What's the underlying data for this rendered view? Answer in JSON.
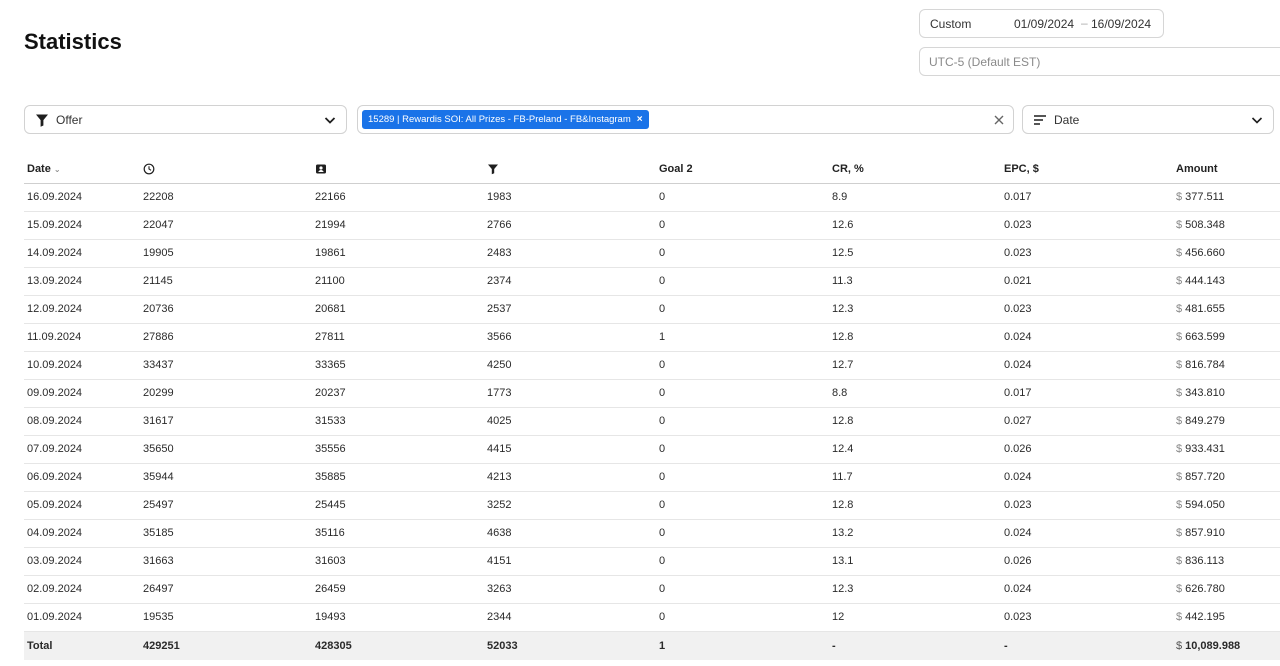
{
  "page": {
    "title": "Statistics"
  },
  "date_range": {
    "preset": "Custom",
    "from": "01/09/2024",
    "separator": "–",
    "to": "16/09/2024"
  },
  "timezone": {
    "value": "UTC-5 (Default EST)"
  },
  "filters": {
    "offer_label": "Offer",
    "selected_chip": "15289 | Rewardis SOI: All Prizes - FB-Preland - FB&Instagram",
    "chip_remove": "×",
    "group_by_label": "Date"
  },
  "colors": {
    "accent": "#1a73e8",
    "total_row_bg": "#f1f1f1"
  },
  "table": {
    "headers": {
      "date": "Date",
      "clicks_icon": "clock-icon",
      "unique_icon": "user-badge-icon",
      "conversions_icon": "funnel-icon",
      "goal2": "Goal 2",
      "cr": "CR, %",
      "epc": "EPC, $",
      "amount": "Amount"
    },
    "currency": "$",
    "rows": [
      {
        "date": "16.09.2024",
        "clicks": "22208",
        "unique": "22166",
        "conv": "1983",
        "goal2": "0",
        "cr": "8.9",
        "epc": "0.017",
        "amount": "377.511"
      },
      {
        "date": "15.09.2024",
        "clicks": "22047",
        "unique": "21994",
        "conv": "2766",
        "goal2": "0",
        "cr": "12.6",
        "epc": "0.023",
        "amount": "508.348"
      },
      {
        "date": "14.09.2024",
        "clicks": "19905",
        "unique": "19861",
        "conv": "2483",
        "goal2": "0",
        "cr": "12.5",
        "epc": "0.023",
        "amount": "456.660"
      },
      {
        "date": "13.09.2024",
        "clicks": "21145",
        "unique": "21100",
        "conv": "2374",
        "goal2": "0",
        "cr": "11.3",
        "epc": "0.021",
        "amount": "444.143"
      },
      {
        "date": "12.09.2024",
        "clicks": "20736",
        "unique": "20681",
        "conv": "2537",
        "goal2": "0",
        "cr": "12.3",
        "epc": "0.023",
        "amount": "481.655"
      },
      {
        "date": "11.09.2024",
        "clicks": "27886",
        "unique": "27811",
        "conv": "3566",
        "goal2": "1",
        "cr": "12.8",
        "epc": "0.024",
        "amount": "663.599"
      },
      {
        "date": "10.09.2024",
        "clicks": "33437",
        "unique": "33365",
        "conv": "4250",
        "goal2": "0",
        "cr": "12.7",
        "epc": "0.024",
        "amount": "816.784"
      },
      {
        "date": "09.09.2024",
        "clicks": "20299",
        "unique": "20237",
        "conv": "1773",
        "goal2": "0",
        "cr": "8.8",
        "epc": "0.017",
        "amount": "343.810"
      },
      {
        "date": "08.09.2024",
        "clicks": "31617",
        "unique": "31533",
        "conv": "4025",
        "goal2": "0",
        "cr": "12.8",
        "epc": "0.027",
        "amount": "849.279"
      },
      {
        "date": "07.09.2024",
        "clicks": "35650",
        "unique": "35556",
        "conv": "4415",
        "goal2": "0",
        "cr": "12.4",
        "epc": "0.026",
        "amount": "933.431"
      },
      {
        "date": "06.09.2024",
        "clicks": "35944",
        "unique": "35885",
        "conv": "4213",
        "goal2": "0",
        "cr": "11.7",
        "epc": "0.024",
        "amount": "857.720"
      },
      {
        "date": "05.09.2024",
        "clicks": "25497",
        "unique": "25445",
        "conv": "3252",
        "goal2": "0",
        "cr": "12.8",
        "epc": "0.023",
        "amount": "594.050"
      },
      {
        "date": "04.09.2024",
        "clicks": "35185",
        "unique": "35116",
        "conv": "4638",
        "goal2": "0",
        "cr": "13.2",
        "epc": "0.024",
        "amount": "857.910"
      },
      {
        "date": "03.09.2024",
        "clicks": "31663",
        "unique": "31603",
        "conv": "4151",
        "goal2": "0",
        "cr": "13.1",
        "epc": "0.026",
        "amount": "836.113"
      },
      {
        "date": "02.09.2024",
        "clicks": "26497",
        "unique": "26459",
        "conv": "3263",
        "goal2": "0",
        "cr": "12.3",
        "epc": "0.024",
        "amount": "626.780"
      },
      {
        "date": "01.09.2024",
        "clicks": "19535",
        "unique": "19493",
        "conv": "2344",
        "goal2": "0",
        "cr": "12",
        "epc": "0.023",
        "amount": "442.195"
      }
    ],
    "total": {
      "label": "Total",
      "clicks": "429251",
      "unique": "428305",
      "conv": "52033",
      "goal2": "1",
      "cr": "-",
      "epc": "-",
      "amount": "10,089.988"
    }
  }
}
